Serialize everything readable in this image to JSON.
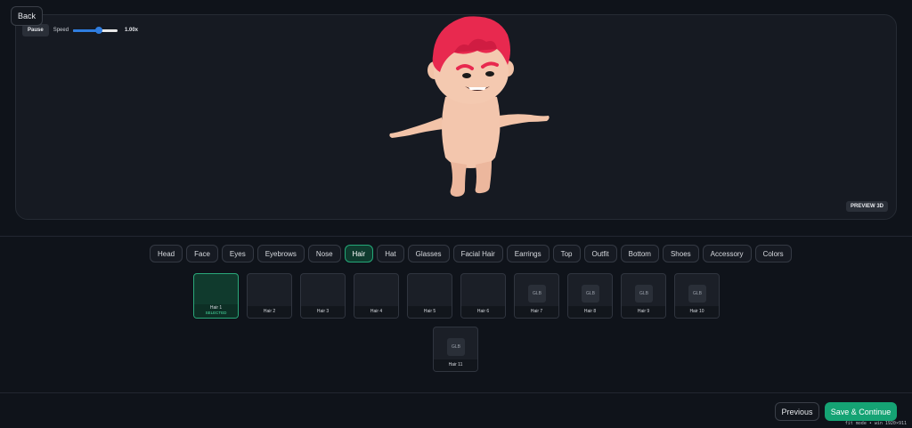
{
  "back_label": "Back",
  "preview": {
    "pause_label": "Pause",
    "speed_label": "Speed",
    "speed_value_text": "1.00x",
    "speed_fraction": 0.58,
    "badge": "PREVIEW 3D",
    "colors": {
      "hair": "#e8294f",
      "skin": "#f2c3a8",
      "accent": "#2f7de0"
    }
  },
  "categories": [
    {
      "label": "Head"
    },
    {
      "label": "Face"
    },
    {
      "label": "Eyes"
    },
    {
      "label": "Eyebrows"
    },
    {
      "label": "Nose"
    },
    {
      "label": "Hair",
      "active": true
    },
    {
      "label": "Hat"
    },
    {
      "label": "Glasses"
    },
    {
      "label": "Facial Hair"
    },
    {
      "label": "Earrings"
    },
    {
      "label": "Top"
    },
    {
      "label": "Outfit"
    },
    {
      "label": "Bottom"
    },
    {
      "label": "Shoes"
    },
    {
      "label": "Accessory"
    },
    {
      "label": "Colors"
    }
  ],
  "items": [
    {
      "label": "Hair 1",
      "status": "SELECTED"
    },
    {
      "label": "Hair 2"
    },
    {
      "label": "Hair 3"
    },
    {
      "label": "Hair 4"
    },
    {
      "label": "Hair 5"
    },
    {
      "label": "Hair 6"
    },
    {
      "label": "Hair 7",
      "thumb": "GLB"
    },
    {
      "label": "Hair 8",
      "thumb": "GLB"
    },
    {
      "label": "Hair 9",
      "thumb": "GLB"
    },
    {
      "label": "Hair 10",
      "thumb": "GLB"
    },
    {
      "label": "Hair 11",
      "thumb": "GLB"
    }
  ],
  "footer": {
    "previous_label": "Previous",
    "save_label": "Save & Continue"
  },
  "fit_note": "fit mode • win 1920×911",
  "theme": {
    "accent_green": "#15a374",
    "background": "#0f131a"
  }
}
